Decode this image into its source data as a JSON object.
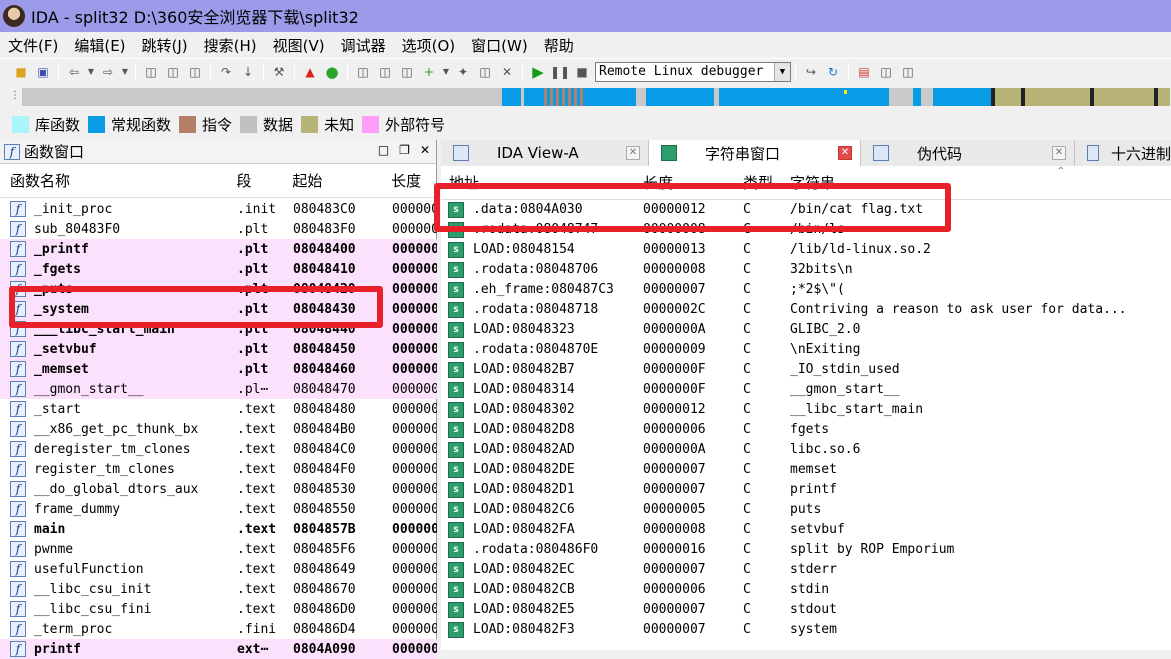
{
  "window": {
    "title": "IDA - split32 D:\\360安全浏览器下载\\split32"
  },
  "menu": [
    "文件(F)",
    "编辑(E)",
    "跳转(J)",
    "搜索(H)",
    "视图(V)",
    "调试器",
    "选项(O)",
    "窗口(W)",
    "帮助"
  ],
  "toolbar": {
    "debugger_selected": "Remote Linux debugger"
  },
  "legend": [
    {
      "label": "库函数",
      "color": "#aaf5fa"
    },
    {
      "label": "常规函数",
      "color": "#0a9be6"
    },
    {
      "label": "指令",
      "color": "#b4806a"
    },
    {
      "label": "数据",
      "color": "#c0c0c0"
    },
    {
      "label": "未知",
      "color": "#b8b478"
    },
    {
      "label": "外部符号",
      "color": "#ff9ef9"
    }
  ],
  "functions_pane": {
    "title": "函数窗口",
    "columns": [
      "函数名称",
      "段",
      "起始",
      "长度"
    ],
    "rows": [
      {
        "name": "_init_proc",
        "seg": ".init",
        "start": "080483C0",
        "len": "000000",
        "style": "normal"
      },
      {
        "name": "sub_80483F0",
        "seg": ".plt",
        "start": "080483F0",
        "len": "000000",
        "style": "normal"
      },
      {
        "name": "_printf",
        "seg": ".plt",
        "start": "08048400",
        "len": "000000",
        "style": "pink-bold"
      },
      {
        "name": "_fgets",
        "seg": ".plt",
        "start": "08048410",
        "len": "000000",
        "style": "pink-bold"
      },
      {
        "name": "_puts",
        "seg": ".plt",
        "start": "08048420",
        "len": "000000",
        "style": "pink-bold"
      },
      {
        "name": "_system",
        "seg": ".plt",
        "start": "08048430",
        "len": "000000",
        "style": "pink-bold"
      },
      {
        "name": "___libc_start_main",
        "seg": ".plt",
        "start": "08048440",
        "len": "000000",
        "style": "pink-bold"
      },
      {
        "name": "_setvbuf",
        "seg": ".plt",
        "start": "08048450",
        "len": "000000",
        "style": "pink-bold"
      },
      {
        "name": "_memset",
        "seg": ".plt",
        "start": "08048460",
        "len": "000000",
        "style": "pink-bold"
      },
      {
        "name": "__gmon_start__",
        "seg": ".pl⋯",
        "start": "08048470",
        "len": "000000",
        "style": "pink"
      },
      {
        "name": "_start",
        "seg": ".text",
        "start": "08048480",
        "len": "000000",
        "style": "normal"
      },
      {
        "name": "__x86_get_pc_thunk_bx",
        "seg": ".text",
        "start": "080484B0",
        "len": "000000",
        "style": "normal"
      },
      {
        "name": "deregister_tm_clones",
        "seg": ".text",
        "start": "080484C0",
        "len": "000000",
        "style": "normal"
      },
      {
        "name": "register_tm_clones",
        "seg": ".text",
        "start": "080484F0",
        "len": "000000",
        "style": "normal"
      },
      {
        "name": "__do_global_dtors_aux",
        "seg": ".text",
        "start": "08048530",
        "len": "000000",
        "style": "normal"
      },
      {
        "name": "frame_dummy",
        "seg": ".text",
        "start": "08048550",
        "len": "000000",
        "style": "normal"
      },
      {
        "name": "main",
        "seg": ".text",
        "start": "0804857B",
        "len": "000000",
        "style": "bold"
      },
      {
        "name": "pwnme",
        "seg": ".text",
        "start": "080485F6",
        "len": "000000",
        "style": "normal"
      },
      {
        "name": "usefulFunction",
        "seg": ".text",
        "start": "08048649",
        "len": "000000",
        "style": "normal"
      },
      {
        "name": "__libc_csu_init",
        "seg": ".text",
        "start": "08048670",
        "len": "000000",
        "style": "normal"
      },
      {
        "name": "__libc_csu_fini",
        "seg": ".text",
        "start": "080486D0",
        "len": "000000",
        "style": "normal"
      },
      {
        "name": "_term_proc",
        "seg": ".fini",
        "start": "080486D4",
        "len": "000000",
        "style": "normal"
      },
      {
        "name": "printf",
        "seg": "ext⋯",
        "start": "0804A090",
        "len": "000000",
        "style": "pink-bold"
      }
    ]
  },
  "tabs": [
    {
      "label": "IDA View-A",
      "active": false
    },
    {
      "label": "字符串窗口",
      "active": true
    },
    {
      "label": "伪代码",
      "active": false
    },
    {
      "label": "十六进制",
      "active": false
    }
  ],
  "strings_pane": {
    "columns": [
      "地址",
      "长度",
      "类型",
      "字符串"
    ],
    "rows": [
      {
        "addr": ".data:0804A030",
        "len": "00000012",
        "type": "C",
        "str": "/bin/cat flag.txt"
      },
      {
        "addr": ".rodata:08048747",
        "len": "00000008",
        "type": "C",
        "str": "/bin/ls"
      },
      {
        "addr": "LOAD:08048154",
        "len": "00000013",
        "type": "C",
        "str": "/lib/ld-linux.so.2"
      },
      {
        "addr": ".rodata:08048706",
        "len": "00000008",
        "type": "C",
        "str": "32bits\\n"
      },
      {
        "addr": ".eh_frame:080487C3",
        "len": "00000007",
        "type": "C",
        "str": ";*2$\\\"("
      },
      {
        "addr": ".rodata:08048718",
        "len": "0000002C",
        "type": "C",
        "str": "Contriving a reason to ask user for data..."
      },
      {
        "addr": "LOAD:08048323",
        "len": "0000000A",
        "type": "C",
        "str": "GLIBC_2.0"
      },
      {
        "addr": ".rodata:0804870E",
        "len": "00000009",
        "type": "C",
        "str": "\\nExiting"
      },
      {
        "addr": "LOAD:080482B7",
        "len": "0000000F",
        "type": "C",
        "str": "_IO_stdin_used"
      },
      {
        "addr": "LOAD:08048314",
        "len": "0000000F",
        "type": "C",
        "str": "__gmon_start__"
      },
      {
        "addr": "LOAD:08048302",
        "len": "00000012",
        "type": "C",
        "str": "__libc_start_main"
      },
      {
        "addr": "LOAD:080482D8",
        "len": "00000006",
        "type": "C",
        "str": "fgets"
      },
      {
        "addr": "LOAD:080482AD",
        "len": "0000000A",
        "type": "C",
        "str": "libc.so.6"
      },
      {
        "addr": "LOAD:080482DE",
        "len": "00000007",
        "type": "C",
        "str": "memset"
      },
      {
        "addr": "LOAD:080482D1",
        "len": "00000007",
        "type": "C",
        "str": "printf"
      },
      {
        "addr": "LOAD:080482C6",
        "len": "00000005",
        "type": "C",
        "str": "puts"
      },
      {
        "addr": "LOAD:080482FA",
        "len": "00000008",
        "type": "C",
        "str": "setvbuf"
      },
      {
        "addr": ".rodata:080486F0",
        "len": "00000016",
        "type": "C",
        "str": "split by ROP Emporium"
      },
      {
        "addr": "LOAD:080482EC",
        "len": "00000007",
        "type": "C",
        "str": "stderr"
      },
      {
        "addr": "LOAD:080482CB",
        "len": "00000006",
        "type": "C",
        "str": "stdin"
      },
      {
        "addr": "LOAD:080482E5",
        "len": "00000007",
        "type": "C",
        "str": "stdout"
      },
      {
        "addr": "LOAD:080482F3",
        "len": "00000007",
        "type": "C",
        "str": "system"
      }
    ]
  }
}
